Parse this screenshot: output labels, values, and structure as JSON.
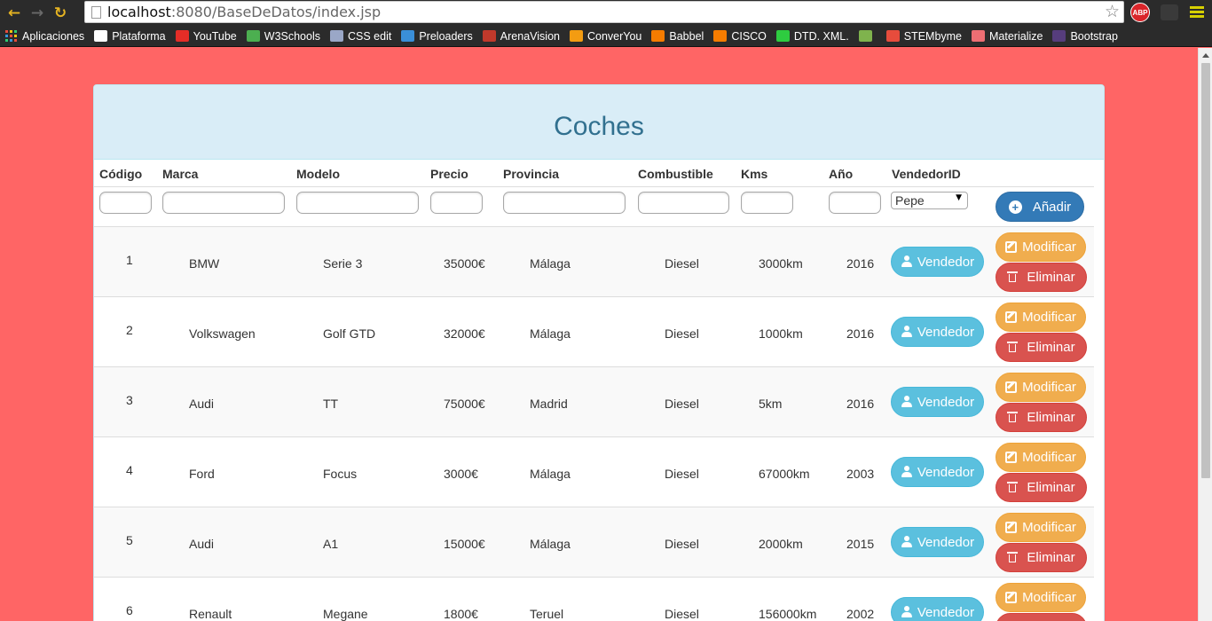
{
  "browser": {
    "url_host": "localhost",
    "url_path": ":8080/BaseDeDatos/index.jsp",
    "extension_abp": "ABP",
    "bookmarks": [
      {
        "label": "Aplicaciones",
        "icon": "apps-grid-icon"
      },
      {
        "label": "Plataforma",
        "icon": "plataforma-icon",
        "color": "#ffffff"
      },
      {
        "label": "YouTube",
        "icon": "youtube-icon",
        "color": "#e52d27"
      },
      {
        "label": "W3Schools",
        "icon": "w3schools-icon",
        "color": "#4caf50"
      },
      {
        "label": "CSS edit",
        "icon": "folder-icon",
        "color": "#9aa7c7"
      },
      {
        "label": "Preloaders",
        "icon": "preloaders-icon",
        "color": "#3a8fd8"
      },
      {
        "label": "ArenaVision",
        "icon": "arenavision-icon",
        "color": "#c0392b"
      },
      {
        "label": "ConverYou",
        "icon": "converyou-icon",
        "color": "#f39c12"
      },
      {
        "label": "Babbel",
        "icon": "babbel-icon",
        "color": "#f57c00"
      },
      {
        "label": "CISCO",
        "icon": "blogger-icon",
        "color": "#f57c00"
      },
      {
        "label": "DTD. XML.",
        "icon": "check-icon",
        "color": "#2ecc40"
      },
      {
        "label": "",
        "icon": "image-icon",
        "color": "#7fb34d"
      },
      {
        "label": "STEMbyme",
        "icon": "stembyme-icon",
        "color": "#e74c3c"
      },
      {
        "label": "Materialize",
        "icon": "materialize-icon",
        "color": "#ee6e73"
      },
      {
        "label": "Bootstrap",
        "icon": "bootstrap-icon",
        "color": "#563d7c"
      }
    ]
  },
  "panel": {
    "title": "Coches"
  },
  "table": {
    "headers": [
      "Código",
      "Marca",
      "Modelo",
      "Precio",
      "Provincia",
      "Combustible",
      "Kms",
      "Año",
      "VendedorID"
    ],
    "vendedor_select": "Pepe",
    "add_label": "Añadir",
    "vendor_label": "Vendedor",
    "modify_label": "Modificar",
    "delete_label": "Eliminar",
    "rows": [
      {
        "codigo": "1",
        "marca": "BMW",
        "modelo": "Serie 3",
        "precio": "35000€",
        "provincia": "Málaga",
        "combustible": "Diesel",
        "kms": "3000km",
        "anio": "2016"
      },
      {
        "codigo": "2",
        "marca": "Volkswagen",
        "modelo": "Golf GTD",
        "precio": "32000€",
        "provincia": "Málaga",
        "combustible": "Diesel",
        "kms": "1000km",
        "anio": "2016"
      },
      {
        "codigo": "3",
        "marca": "Audi",
        "modelo": "TT",
        "precio": "75000€",
        "provincia": "Madrid",
        "combustible": "Diesel",
        "kms": "5km",
        "anio": "2016"
      },
      {
        "codigo": "4",
        "marca": "Ford",
        "modelo": "Focus",
        "precio": "3000€",
        "provincia": "Málaga",
        "combustible": "Diesel",
        "kms": "67000km",
        "anio": "2003"
      },
      {
        "codigo": "5",
        "marca": "Audi",
        "modelo": "A1",
        "precio": "15000€",
        "provincia": "Málaga",
        "combustible": "Diesel",
        "kms": "2000km",
        "anio": "2015"
      },
      {
        "codigo": "6",
        "marca": "Renault",
        "modelo": "Megane",
        "precio": "1800€",
        "provincia": "Teruel",
        "combustible": "Diesel",
        "kms": "156000km",
        "anio": "2002"
      }
    ]
  },
  "colors": {
    "page_bg": "#ff6565",
    "heading_bg": "#d9edf7",
    "heading_text": "#31708f",
    "btn_primary": "#337ab7",
    "btn_info": "#5bc0de",
    "btn_warning": "#f0ad4e",
    "btn_danger": "#d9534f"
  }
}
